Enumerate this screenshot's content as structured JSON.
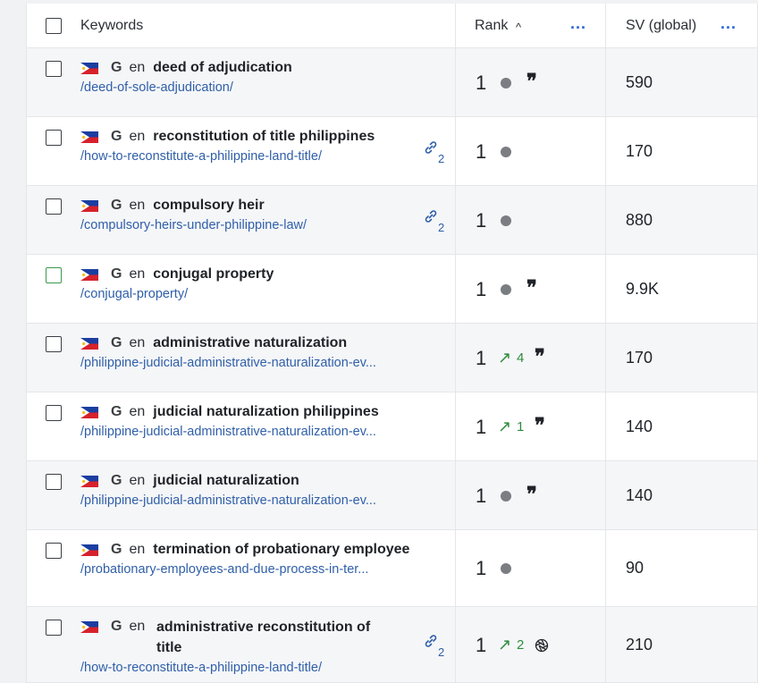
{
  "header": {
    "keywords_label": "Keywords",
    "rank_label": "Rank",
    "rank_sort_icon": "^",
    "sv_label": "SV (global)",
    "more_label": "..."
  },
  "rows": [
    {
      "lang": "en",
      "keyword": "deed of adjudication",
      "url": "/deed-of-sole-adjudication/",
      "rank": "1",
      "change": "",
      "feature": "quote",
      "links": "",
      "sv": "590"
    },
    {
      "lang": "en",
      "keyword": "reconstitution of title philippines",
      "url": "/how-to-reconstitute-a-philippine-land-title/",
      "rank": "1",
      "change": "",
      "feature": "",
      "links": "2",
      "sv": "170"
    },
    {
      "lang": "en",
      "keyword": "compulsory heir",
      "url": "/compulsory-heirs-under-philippine-law/",
      "rank": "1",
      "change": "",
      "feature": "",
      "links": "2",
      "sv": "880"
    },
    {
      "lang": "en",
      "keyword": "conjugal property",
      "url": "/conjugal-property/",
      "rank": "1",
      "change": "",
      "feature": "quote",
      "links": "",
      "sv": "9.9K"
    },
    {
      "lang": "en",
      "keyword": "administrative naturalization",
      "url": "/philippine-judicial-administrative-naturalization-ev...",
      "rank": "1",
      "change": "4",
      "feature": "quote",
      "links": "",
      "sv": "170"
    },
    {
      "lang": "en",
      "keyword": "judicial naturalization philippines",
      "url": "/philippine-judicial-administrative-naturalization-ev...",
      "rank": "1",
      "change": "1",
      "feature": "quote",
      "links": "",
      "sv": "140"
    },
    {
      "lang": "en",
      "keyword": "judicial naturalization",
      "url": "/philippine-judicial-administrative-naturalization-ev...",
      "rank": "1",
      "change": "",
      "feature": "quote",
      "links": "",
      "sv": "140"
    },
    {
      "lang": "en",
      "keyword": "termination of probationary employee",
      "url": "/probationary-employees-and-due-process-in-ter...",
      "rank": "1",
      "change": "",
      "feature": "",
      "links": "",
      "sv": "90"
    },
    {
      "lang": "en",
      "keyword": "administrative reconstitution of title",
      "url": "/how-to-reconstitute-a-philippine-land-title/",
      "rank": "1",
      "change": "2",
      "feature": "aperture",
      "links": "2",
      "sv": "210"
    }
  ],
  "colors": {
    "link_blue": "#2f5fa8",
    "accent_blue": "#2a66d6",
    "up_green": "#2e8b3d",
    "dot_gray": "#7a7d82"
  },
  "icons": {
    "flag": "philippines-flag-icon",
    "search_engine": "google-icon",
    "quote": "featured-snippet-quote-icon",
    "link": "link-icon",
    "up": "arrow-up-right-icon",
    "aperture": "aperture-icon"
  },
  "google_letter": "G",
  "quote_glyph": "❞",
  "up_glyph": "↗"
}
